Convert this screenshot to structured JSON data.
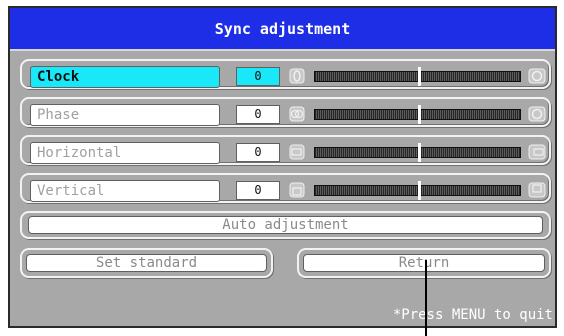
{
  "title": "Sync adjustment",
  "rows": [
    {
      "label": "Clock",
      "value": "0",
      "active": true,
      "icon": "circle-coarse-icon",
      "end_icon": "circle-fine-icon"
    },
    {
      "label": "Phase",
      "value": "0",
      "active": false,
      "icon": "double-circle-icon",
      "end_icon": "circle-fine-icon"
    },
    {
      "label": "Horizontal",
      "value": "0",
      "active": false,
      "icon": "horizontal-shift-icon",
      "end_icon": "horizontal-shift-right-icon"
    },
    {
      "label": "Vertical",
      "value": "0",
      "active": false,
      "icon": "vertical-shift-icon",
      "end_icon": "vertical-shift-up-icon"
    }
  ],
  "auto_adjustment": "Auto adjustment",
  "set_standard": "Set standard",
  "return": "Return",
  "footer_note": "*Press MENU to quit",
  "colors": {
    "title_bar": "#1e2ee6",
    "highlight": "#18e8f8",
    "panel": "#a8a8a8"
  }
}
